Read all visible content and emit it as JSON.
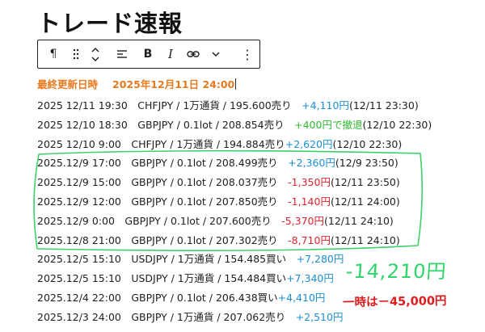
{
  "title": "トレード速報",
  "toolbar": {
    "paragraph_glyph": "¶",
    "drag_glyph": "⠿",
    "bold_glyph": "B",
    "italic_glyph": "I",
    "more_glyph": "⋮"
  },
  "updated": {
    "label": "最終更新日時",
    "value": "2025年12月11日 24:00"
  },
  "trades": [
    {
      "text": "2025 12/11 19:30　CHFJPY / 1万通貨 / 195.600売り　",
      "result": "+4,110円",
      "result_type": "pos",
      "close": "(12/11 23:30)"
    },
    {
      "text": "2025 12/10 18:30　GBPJPY / 0.1lot / 208.854売り　",
      "result": "+400円で撤退",
      "result_type": "grn",
      "close": "(12/10 22:30)"
    },
    {
      "text": "2025 12/10 9:00　CHFJPY / 1万通貨 / 194.884売り",
      "result": "+2,620円",
      "result_type": "pos",
      "close": "(12/10 22:30)"
    },
    {
      "text": "2025.12/9 17:00　GBPJPY / 0.1lot / 208.499売り　",
      "result": "+2,360円",
      "result_type": "pos",
      "close": "(12/9 23:50)"
    },
    {
      "text": "2025.12/9 15:00　GBPJPY / 0.1lot / 208.037売り　",
      "result": "-1,350円",
      "result_type": "neg",
      "close": "(12/11 23:50)"
    },
    {
      "text": "2025.12/9 12:00　GBPJPY / 0.1lot / 207.850売り　",
      "result": "-1,140円",
      "result_type": "neg",
      "close": "(12/11 24:00)"
    },
    {
      "text": "2025.12/9 0:00　GBPJPY / 0.1lot / 207.600売り　",
      "result": "-5,370円",
      "result_type": "neg",
      "close": "(12/11 24:10)"
    },
    {
      "text": "2025.12/8 21:00　GBPJPY / 0.1lot / 207.302売り　",
      "result": "-8,710円",
      "result_type": "neg",
      "close": "(12/11 24:10)"
    },
    {
      "text": "2025.12/5 15:10　USDJPY / 1万通貨 / 154.485買い　",
      "result": "+7,280円",
      "result_type": "pos",
      "close": ""
    },
    {
      "text": "2025.12/5 15:10　USDJPY / 1万通貨 / 154.484買い",
      "result": "+7,340円",
      "result_type": "pos",
      "close": ""
    },
    {
      "text": "2025.12/4 22:00　GBPJPY / 0.1lot / 206.438買い",
      "result": "+4,410円",
      "result_type": "pos",
      "close": ""
    },
    {
      "text": "2025.12/3 24:00　GBPJPY / 1万通貨 / 207.062売り　",
      "result": "+2,510円",
      "result_type": "pos",
      "close": ""
    }
  ],
  "handwritten": {
    "total": "-14,210円",
    "note": "一時は－45,000円"
  },
  "colors": {
    "accent_orange": "#e8791e",
    "positive_blue": "#1a8fd6",
    "negative_red": "#e0242c",
    "withdraw_green": "#2fb82f",
    "hand_green": "#2fd46a",
    "hand_red": "#e01b1b"
  }
}
